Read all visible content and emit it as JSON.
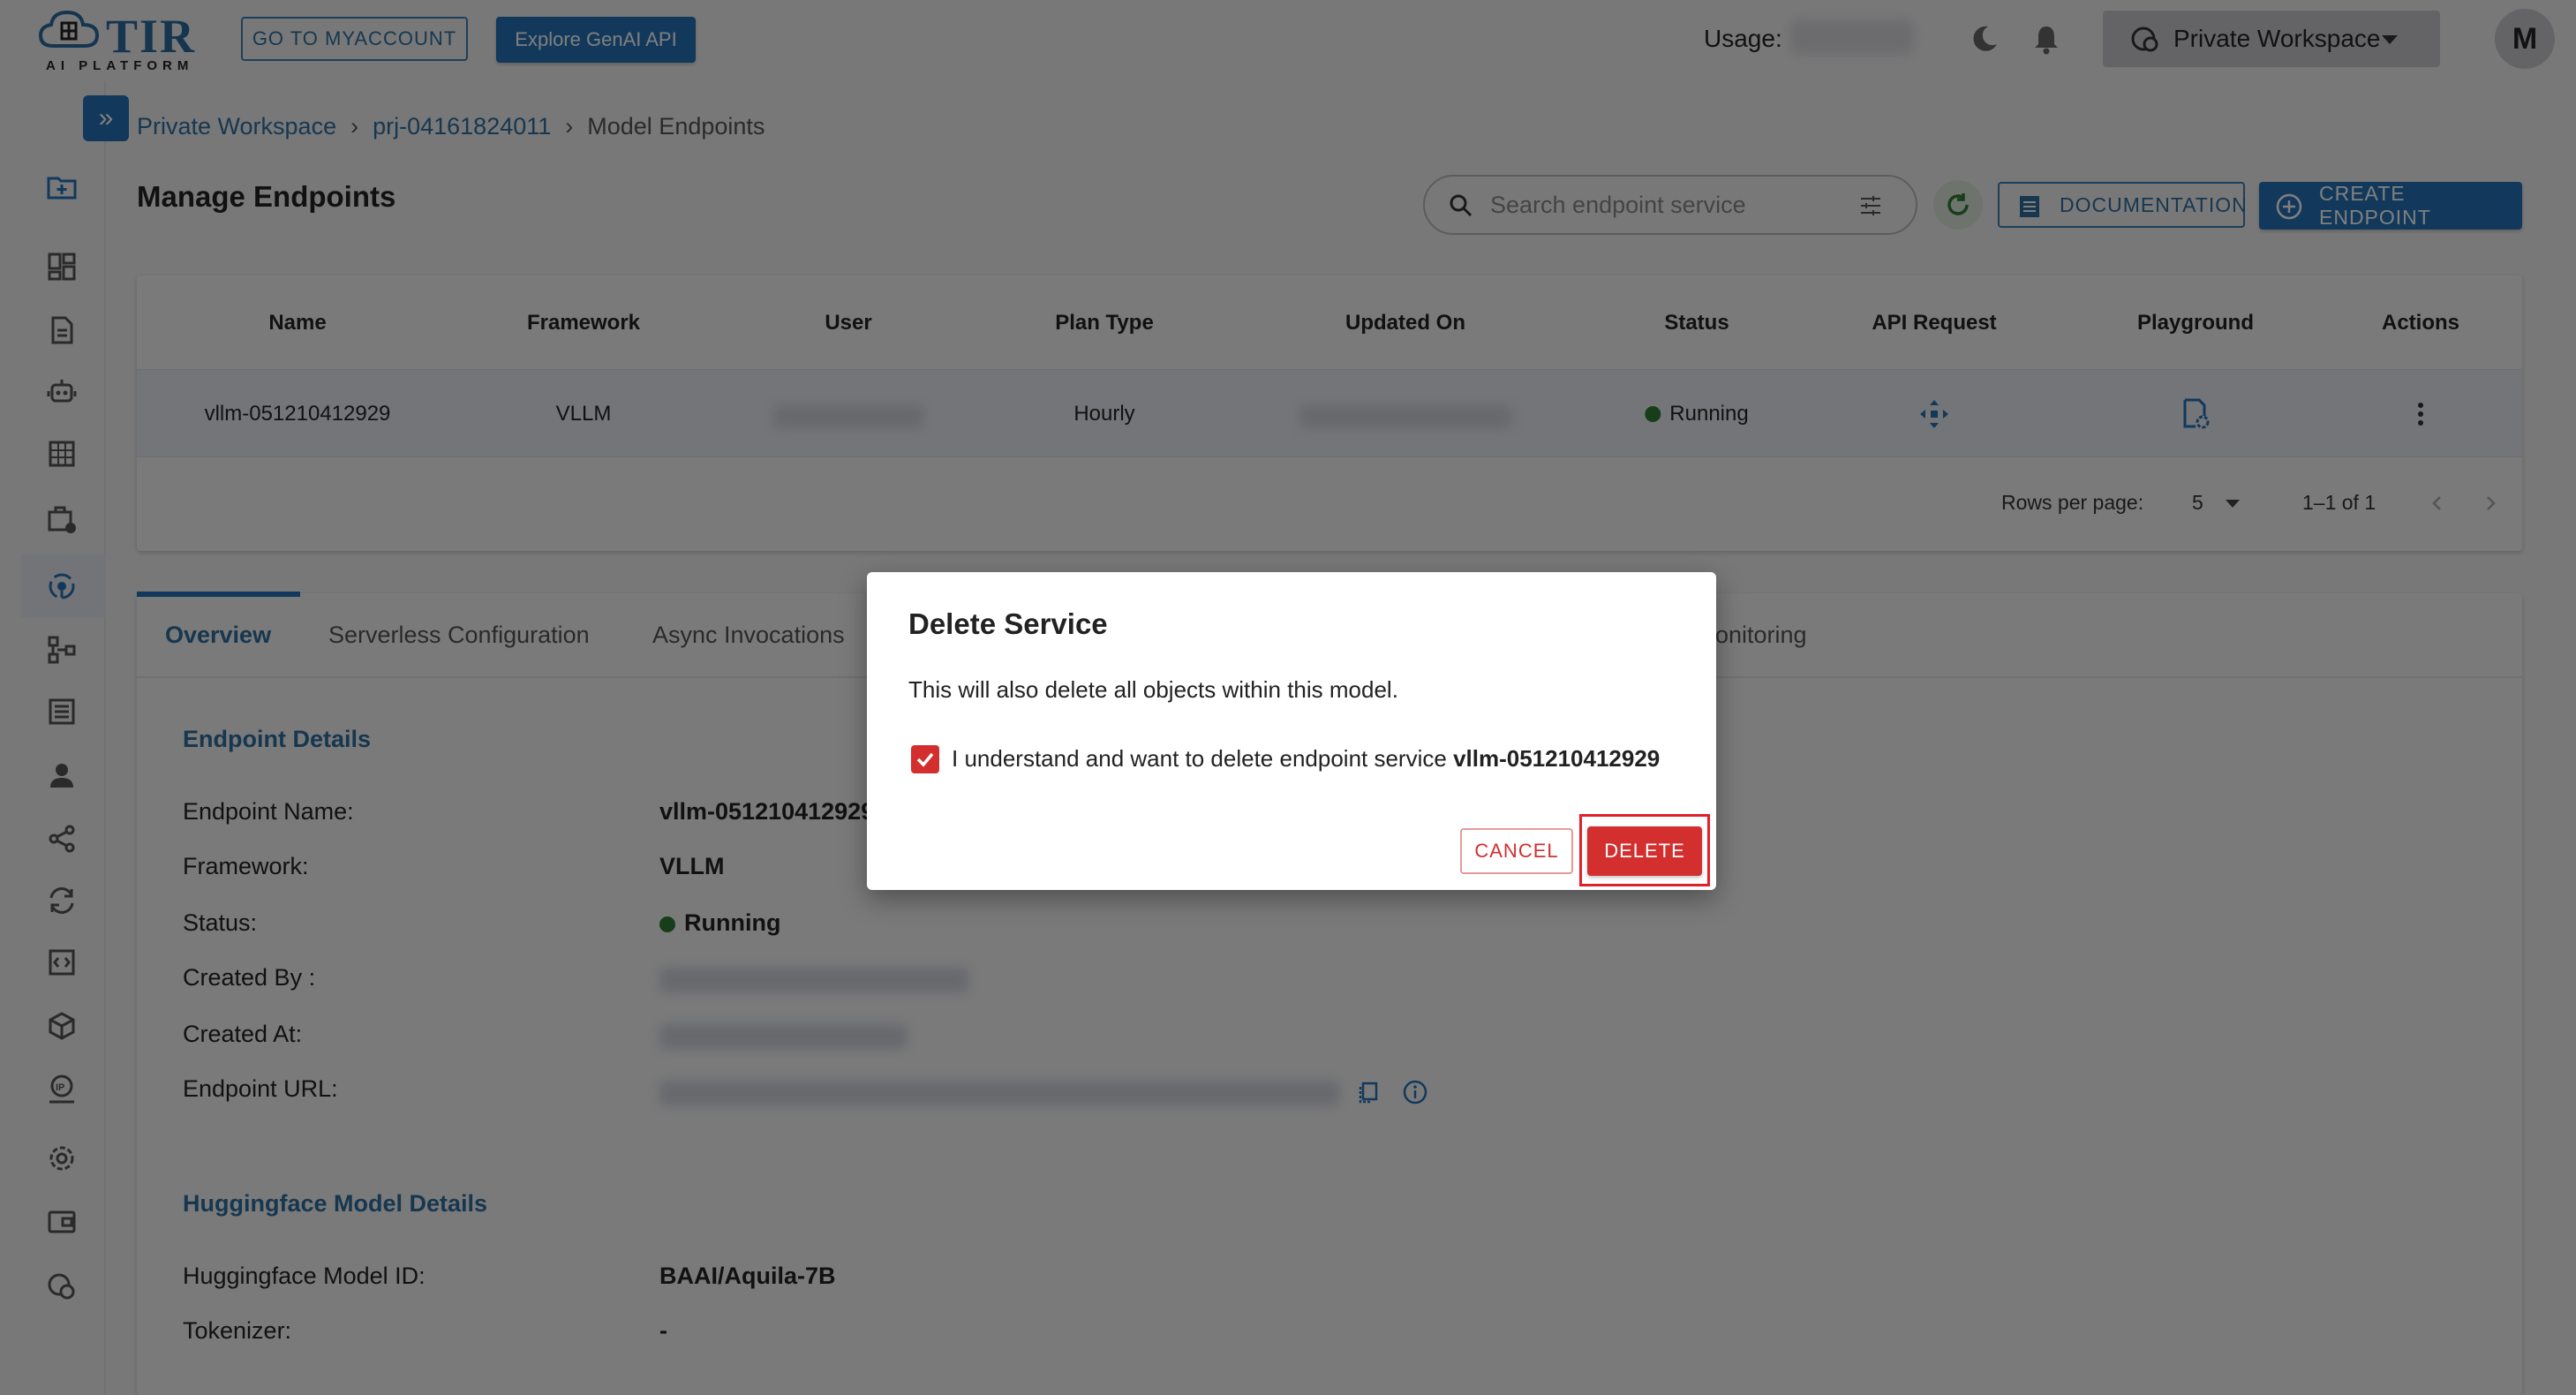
{
  "header": {
    "logo_text": "TIR",
    "logo_sub": "AI PLATFORM",
    "go_to_myaccount": "GO TO MYACCOUNT",
    "explore_genai": "Explore GenAI API",
    "usage_label": "Usage:",
    "workspace_label": "Private Workspace",
    "avatar_initial": "M"
  },
  "sidebar": {
    "icons": [
      "folder-add-icon",
      "dashboard-icon",
      "notebook-icon",
      "robot-icon",
      "grid-icon",
      "storage-icon",
      "model-endpoints-icon",
      "pipeline-icon",
      "dataset-icon",
      "user-icon",
      "share-icon",
      "sync-icon",
      "code-icon",
      "package-icon",
      "ip-icon",
      "settings-icon",
      "wallet-icon",
      "workspace-icon"
    ]
  },
  "breadcrumb": {
    "item1": "Private Workspace",
    "item2": "prj-04161824011",
    "item3": "Model Endpoints",
    "sep": "›"
  },
  "page": {
    "title": "Manage Endpoints",
    "search_placeholder": "Search endpoint service",
    "documentation": "DOCUMENTATION",
    "create_endpoint": "CREATE ENDPOINT"
  },
  "table": {
    "headers": [
      "Name",
      "Framework",
      "User",
      "Plan Type",
      "Updated On",
      "Status",
      "API Request",
      "Playground",
      "Actions"
    ],
    "rows": [
      {
        "name": "vllm-051210412929",
        "framework": "VLLM",
        "plan_type": "Hourly",
        "status": "Running"
      }
    ],
    "rows_per_page_label": "Rows per page:",
    "rows_per_page": "5",
    "range": "1–1 of 1"
  },
  "tabs": [
    "Overview",
    "Serverless Configuration",
    "Async Invocations",
    "Monitoring"
  ],
  "tab_monitoring_visible": "onitoring",
  "overview": {
    "endpoint_details_title": "Endpoint Details",
    "endpoint_name_label": "Endpoint Name:",
    "endpoint_name_value": "vllm-051210412929",
    "framework_label": "Framework:",
    "framework_value": "VLLM",
    "status_label": "Status:",
    "status_value": "Running",
    "created_by_label": "Created By :",
    "created_at_label": "Created At:",
    "endpoint_url_label": "Endpoint URL:",
    "hf_title": "Huggingface Model Details",
    "hf_model_id_label": "Huggingface Model ID:",
    "hf_model_id_value": "BAAI/Aquila-7B",
    "tokenizer_label": "Tokenizer:",
    "tokenizer_value": "-"
  },
  "dialog": {
    "title": "Delete Service",
    "message": "This will also delete all objects within this model.",
    "checkbox_text": "I understand and want to delete endpoint service",
    "checkbox_target": "vllm-051210412929",
    "cancel": "CANCEL",
    "delete": "DELETE"
  },
  "colors": {
    "primary": "#2473b6",
    "danger": "#d32f2f",
    "running": "#2e7d32"
  }
}
